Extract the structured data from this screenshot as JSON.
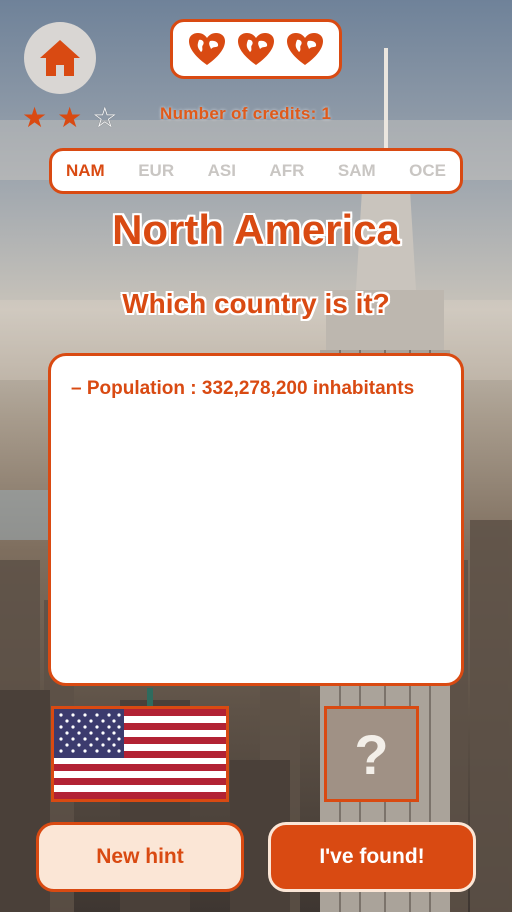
{
  "colors": {
    "accent": "#d94a12",
    "hint_bg": "#fbe6d6",
    "inactive_tab": "#c9c6c3"
  },
  "header": {
    "home_icon": "home-icon",
    "lives": [
      {
        "icon": "heart-globe-icon"
      },
      {
        "icon": "heart-globe-icon"
      },
      {
        "icon": "heart-globe-icon"
      }
    ],
    "stars": {
      "filled": 2,
      "total": 3
    },
    "credits_label": "Number of credits: 1"
  },
  "tabs": [
    {
      "label": "NAM",
      "active": true
    },
    {
      "label": "EUR",
      "active": false
    },
    {
      "label": "ASI",
      "active": false
    },
    {
      "label": "AFR",
      "active": false
    },
    {
      "label": "SAM",
      "active": false
    },
    {
      "label": "OCE",
      "active": false
    }
  ],
  "region_title": "North America",
  "question": "Which country is it?",
  "hints": [
    "– Population : 332,278,200 inhabitants"
  ],
  "cards": {
    "mystery_label": "?"
  },
  "buttons": {
    "new_hint": "New hint",
    "found": "I've found!"
  }
}
